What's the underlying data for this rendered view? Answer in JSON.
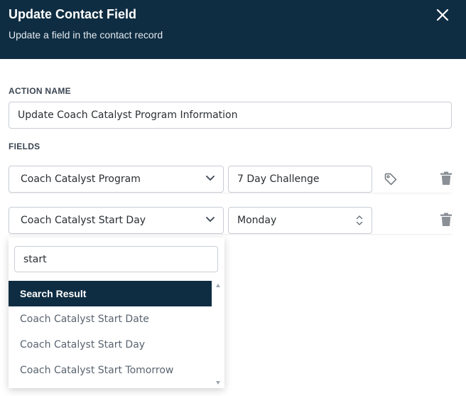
{
  "header": {
    "title": "Update Contact Field",
    "subtitle": "Update a field in the contact record"
  },
  "action_name": {
    "label": "ACTION NAME",
    "value": "Update Coach Catalyst Program Information"
  },
  "fields": {
    "label": "FIELDS",
    "rows": [
      {
        "field": "Coach Catalyst Program",
        "value": "7 Day Challenge",
        "value_type": "text",
        "icons": [
          "tag-icon",
          "trash-icon"
        ]
      },
      {
        "field": "Coach Catalyst Start Day",
        "value": "Monday",
        "value_type": "select",
        "icons": [
          "trash-icon"
        ]
      }
    ]
  },
  "dropdown": {
    "search_value": "start",
    "group_header": "Search Result",
    "options": [
      "Coach Catalyst Start Date",
      "Coach Catalyst Start Day",
      "Coach Catalyst Start Tomorrow"
    ]
  },
  "colors": {
    "header_bg": "#0f2d42",
    "border": "#c9ced4",
    "icon_gray": "#8a9096"
  }
}
